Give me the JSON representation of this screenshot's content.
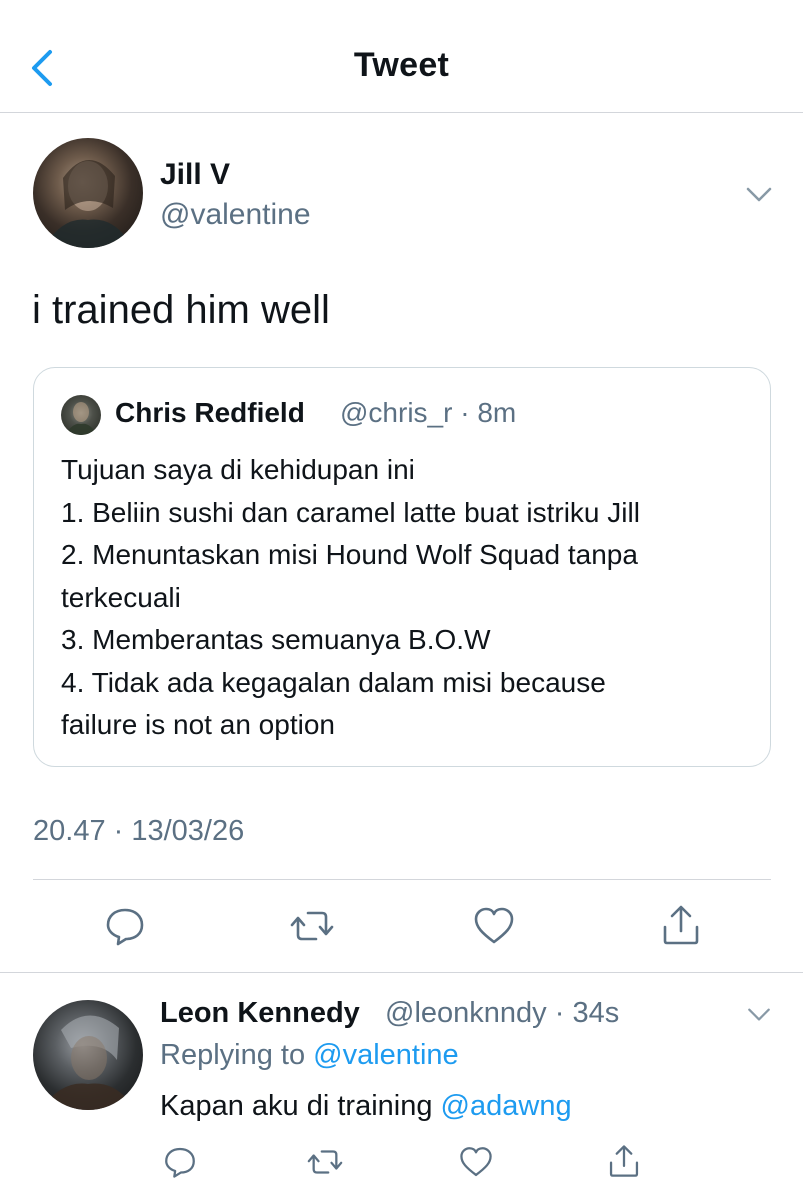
{
  "header": {
    "title": "Tweet"
  },
  "tweet": {
    "author_name": "Jill V",
    "author_handle": "@valentine",
    "text": "i trained him well",
    "timestamp": "20.47 · 13/03/26"
  },
  "quote": {
    "author_name": "Chris Redfield",
    "author_handle": "@chris_r",
    "time": "8m",
    "separator": "·",
    "lines": [
      "Tujuan saya di kehidupan ini",
      "1. Beliin sushi dan caramel latte buat istriku Jill",
      "2. Menuntaskan misi Hound Wolf Squad tanpa",
      "terkecuali",
      "3. Memberantas semuanya B.O.W",
      "4. Tidak ada kegagalan dalam misi because",
      "failure is not an option"
    ]
  },
  "reply": {
    "author_name": "Leon Kennedy",
    "author_handle": "@leonknndy",
    "separator": "·",
    "time": "34s",
    "replying_label": "Replying to",
    "replying_handle": "@valentine",
    "text_prefix": "Kapan aku di training",
    "mention": "@adawng"
  },
  "icons": {
    "back": "chevron-left-icon",
    "more": "chevron-down-icon",
    "reply": "comment-icon",
    "retweet": "retweet-icon",
    "like": "heart-icon",
    "share": "share-icon"
  },
  "colors": {
    "accent": "#1d9bf0",
    "secondary_text": "#5b7083",
    "border": "#d3d6db"
  }
}
